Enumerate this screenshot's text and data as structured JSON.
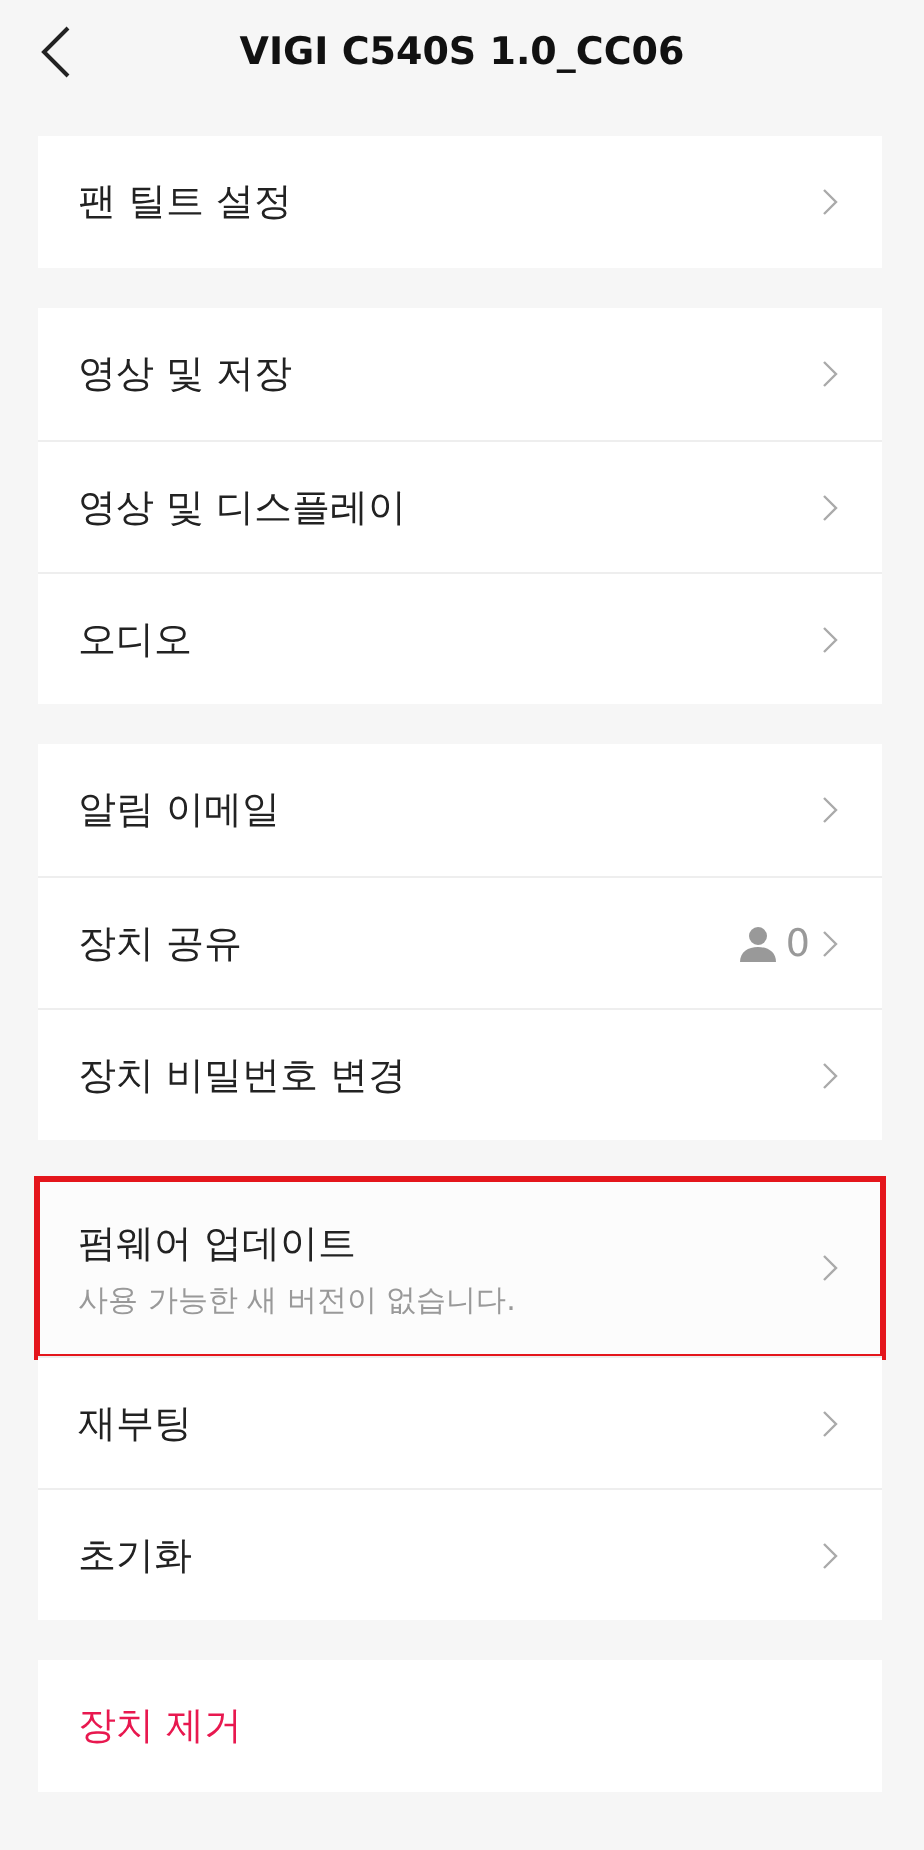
{
  "header": {
    "title": "VIGI C540S 1.0_CC06"
  },
  "groups": [
    {
      "items": [
        {
          "kind": "link",
          "label": "팬 틸트 설정",
          "highlighted": false
        }
      ]
    },
    {
      "items": [
        {
          "kind": "link",
          "label": "영상 및 저장",
          "highlighted": false
        },
        {
          "kind": "link",
          "label": "영상 및 디스플레이",
          "highlighted": false
        },
        {
          "kind": "link",
          "label": "오디오",
          "highlighted": false
        }
      ]
    },
    {
      "items": [
        {
          "kind": "link",
          "label": "알림 이메일",
          "highlighted": false
        },
        {
          "kind": "count",
          "label": "장치 공유",
          "count": "0",
          "highlighted": false
        },
        {
          "kind": "link",
          "label": "장치 비밀번호 변경",
          "highlighted": false
        }
      ]
    },
    {
      "items": [
        {
          "kind": "subtitle",
          "label": "펌웨어 업데이트",
          "subtitle": "사용 가능한 새 버전이 없습니다.",
          "highlighted": true
        },
        {
          "kind": "link",
          "label": "재부팅",
          "highlighted": false
        },
        {
          "kind": "link",
          "label": "초기화",
          "highlighted": false
        }
      ]
    },
    {
      "items": [
        {
          "kind": "danger",
          "label": "장치 제거",
          "highlighted": false
        }
      ]
    }
  ]
}
